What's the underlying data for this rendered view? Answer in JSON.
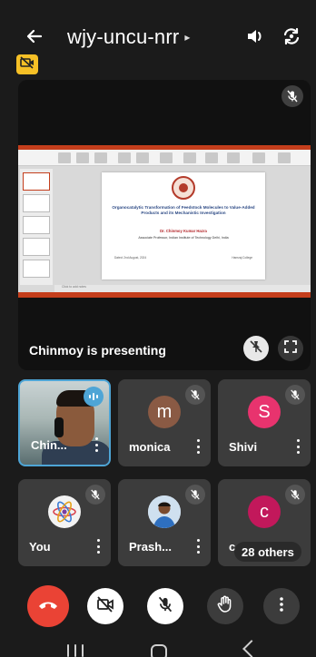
{
  "header": {
    "meeting_code": "wjy-uncu-nrr",
    "chevron": "▸",
    "icons": [
      "back-arrow-icon",
      "speaker-icon",
      "camera-flip-icon"
    ]
  },
  "camera_off_badge": {
    "icon": "camera-off-icon",
    "color": "#f6c026"
  },
  "presentation": {
    "slide": {
      "title": "Organocatalytic Transformation of Feedstock Molecules to Value-Added Products and its Mechanistic Investigation",
      "author": "Dr. Chinmoy Kumar Hazra",
      "affiliation": "Associate Professor, Indian Institute of Technology Delhi, India",
      "date": "Dated: 2nd August, 2024",
      "college": "Hansraj College",
      "notes": "Click to add notes"
    },
    "presenting_label": "Chinmoy is presenting",
    "icons": [
      "mic-off-icon",
      "pin-off-icon",
      "fullscreen-icon"
    ]
  },
  "participants": [
    {
      "name": "Chin...",
      "type": "video",
      "talking": true
    },
    {
      "name": "monica",
      "initial": "m",
      "avatar_color": "#8a5a44",
      "muted": true
    },
    {
      "name": "Shivi",
      "initial": "S",
      "avatar_color": "#e8336e",
      "muted": true
    },
    {
      "name": "You",
      "type": "image-atom",
      "muted": true
    },
    {
      "name": "Prash...",
      "type": "image-person",
      "muted": true
    },
    {
      "name": "c",
      "initial": "c",
      "avatar_color": "#c2185b",
      "muted": true
    }
  ],
  "others_label": "28 others",
  "controls": {
    "end_call": {
      "icon": "end-call-icon",
      "color": "#ea4335"
    },
    "camera": {
      "icon": "camera-off-icon"
    },
    "microphone": {
      "icon": "mic-off-icon"
    },
    "raise_hand": {
      "icon": "raise-hand-icon"
    },
    "more": {
      "icon": "more-vert-icon"
    }
  },
  "colors": {
    "background": "#1b1b1b",
    "tile": "#3c3c3c",
    "active_speaker": "#4ea5d6",
    "ppt_accent": "#c43e1c"
  }
}
